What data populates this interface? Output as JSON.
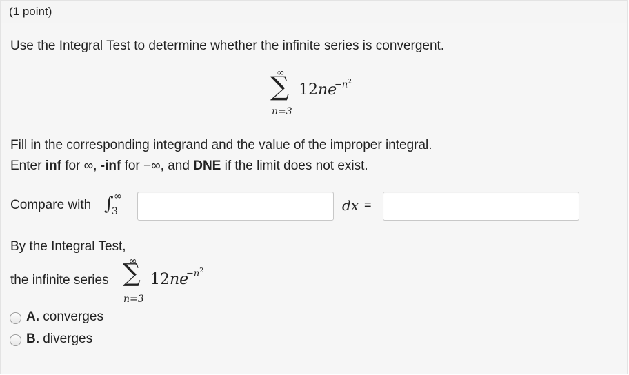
{
  "header": {
    "points": "(1 point)"
  },
  "prompt": "Use the Integral Test to determine whether the infinite series is convergent.",
  "series": {
    "upper": "∞",
    "sigma": "∑",
    "term_coeff": "12",
    "term_var": "ne",
    "exponent": "−n",
    "exponent_power": "2",
    "lower": "n=3"
  },
  "instructions": {
    "line1": "Fill in the corresponding integrand and the value of the improper integral.",
    "line2_part1": "Enter ",
    "inf": "inf",
    "line2_part2": " for ∞, ",
    "neg_inf": "-inf",
    "line2_part3": " for −∞, and ",
    "dne": "DNE",
    "line2_part4": " if the limit does not exist."
  },
  "compare": {
    "label": "Compare with",
    "integral_sign": "∫",
    "upper": "∞",
    "lower": "3",
    "integrand_value": "",
    "dx_label": "dx",
    "equals": "=",
    "result_value": ""
  },
  "conclusion": {
    "line1": "By the Integral Test,",
    "line2": "the infinite series"
  },
  "options": [
    {
      "letter": "A.",
      "text": "converges"
    },
    {
      "letter": "B.",
      "text": "diverges"
    }
  ]
}
